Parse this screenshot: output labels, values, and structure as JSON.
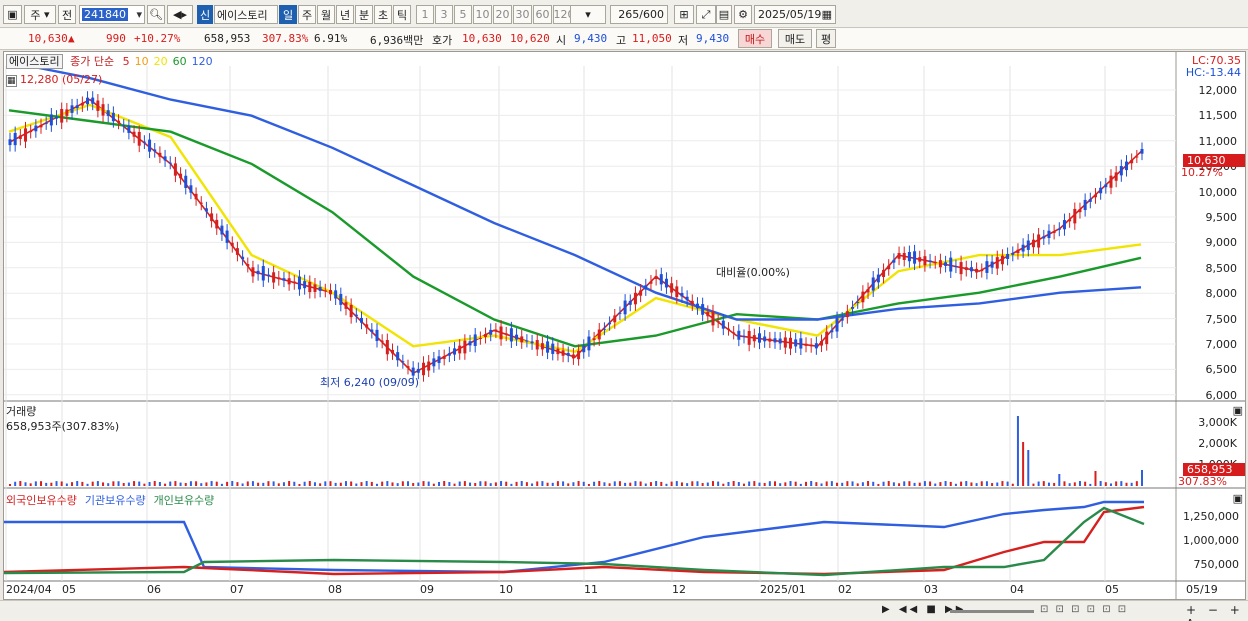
{
  "toolbar": {
    "period_prefix": "주",
    "prev_label": "전",
    "stock_code": "241840",
    "badge_new": "신",
    "stock_name": "에이스토리",
    "periods": [
      "일",
      "주",
      "월",
      "년",
      "분",
      "초",
      "틱"
    ],
    "active_period": "일",
    "minute_steps": [
      "1",
      "3",
      "5",
      "10",
      "20",
      "30",
      "60",
      "120"
    ],
    "count_value": "265",
    "count_total": "/600",
    "date_value": "2025/05/19"
  },
  "quote": {
    "price": "10,630",
    "change_arrow": "▲",
    "change": "990",
    "change_pct": "+10.27%",
    "volume": "658,953",
    "volume_ratio": "307.83%",
    "turnover_rate": "6.91%",
    "trade_value": "6,936백만",
    "bid_label": "호가",
    "ask": "10,630",
    "bid": "10,620",
    "open_label": "시",
    "open": "9,430",
    "high_label": "고",
    "high": "11,050",
    "low_label": "저",
    "low": "9,430",
    "buy_label": "매수",
    "sell_label": "매도",
    "eval_label": "평"
  },
  "price_panel": {
    "stock_tag": "에이스토리",
    "ma_title": "종가 단순",
    "ma_periods": [
      "5",
      "10",
      "20",
      "60",
      "120"
    ],
    "ma_colors": [
      "#d62020",
      "#f39c12",
      "#f0e400",
      "#1a9a2a",
      "#2f5fe0"
    ],
    "lc_label": "LC:70.35",
    "hc_label": "HC:-13.44",
    "high_marker": "12,280 (05/27)",
    "low_marker": "최저 6,240 (09/09)",
    "ref_marker": "대비율(0.00%)",
    "last_price_tag": "10,630",
    "last_pct_tag": "10.27%",
    "y_ticks": [
      "12,000",
      "11,500",
      "11,000",
      "10,500",
      "10,000",
      "9,500",
      "9,000",
      "8,500",
      "8,000",
      "7,500",
      "7,000",
      "6,500",
      "6,000"
    ]
  },
  "volume_panel": {
    "title": "거래량",
    "value_line": "658,953주(307.83%)",
    "y_ticks": [
      "3,000K",
      "2,000K",
      "1,000K"
    ],
    "last_tag": "658,953",
    "last_pct": "307.83%"
  },
  "holdings_panel": {
    "series": [
      {
        "name": "외국인보유수량",
        "color": "#d62020"
      },
      {
        "name": "기관보유수량",
        "color": "#2f5fe0"
      },
      {
        "name": "개인보유수량",
        "color": "#2a8a4a"
      }
    ],
    "y_ticks": [
      "1,250,000",
      "1,000,000",
      "750,000"
    ]
  },
  "x_axis": [
    "2024/04",
    "05",
    "06",
    "07",
    "08",
    "09",
    "10",
    "11",
    "12",
    "2025/01",
    "02",
    "03",
    "04",
    "05",
    "05/19"
  ],
  "chart_data": {
    "type": "line",
    "title": "에이스토리",
    "x": [
      "2024/04",
      "05",
      "06",
      "07",
      "08",
      "09",
      "10",
      "11",
      "12",
      "2025/01",
      "02",
      "03",
      "04",
      "05",
      "05/19"
    ],
    "ylim": [
      6000,
      12300
    ],
    "series": [
      {
        "name": "5",
        "values": [
          10800,
          11600,
          10400,
          8400,
          8000,
          6500,
          7300,
          6800,
          8300,
          7200,
          7000,
          8700,
          8400,
          9200,
          10630
        ]
      },
      {
        "name": "20",
        "values": [
          11000,
          11500,
          10900,
          8700,
          8000,
          7000,
          7200,
          6900,
          7900,
          7500,
          7200,
          8400,
          8700,
          8700,
          8900
        ]
      },
      {
        "name": "60",
        "values": [
          11400,
          11200,
          11000,
          10400,
          9500,
          8300,
          7500,
          7000,
          7200,
          7600,
          7500,
          7800,
          8000,
          8300,
          8650
        ]
      },
      {
        "name": "120",
        "values": [
          12300,
          12000,
          11600,
          11300,
          10700,
          10000,
          9300,
          8700,
          8000,
          7500,
          7500,
          7700,
          7800,
          8000,
          8100
        ]
      }
    ],
    "annotations": [
      "12,280 (05/27)",
      "최저 6,240 (09/09)"
    ]
  }
}
